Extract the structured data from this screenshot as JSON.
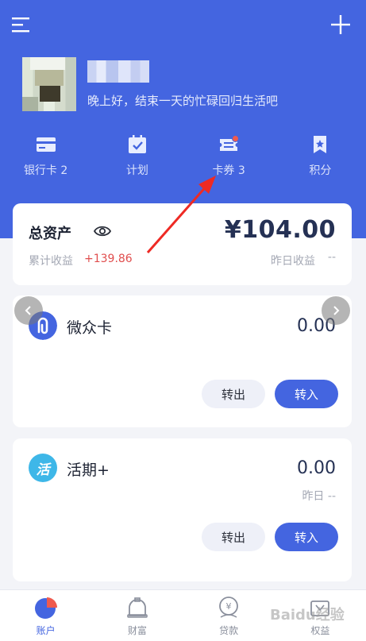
{
  "header": {
    "greeting": "晚上好，结束一天的忙碌回归生活吧"
  },
  "quick_nav": [
    {
      "label": "银行卡 2",
      "icon": "bank-card-icon"
    },
    {
      "label": "计划",
      "icon": "plan-calendar-icon"
    },
    {
      "label": "卡券 3",
      "icon": "coupon-icon",
      "badge": true
    },
    {
      "label": "积分",
      "icon": "points-bookmark-icon"
    }
  ],
  "assets": {
    "title": "总资产",
    "amount": "¥104.00",
    "cumulative_label": "累计收益",
    "cumulative_value": "+139.86",
    "yesterday_label": "昨日收益",
    "yesterday_value": "--"
  },
  "products": [
    {
      "name": "微众卡",
      "amount": "0.00",
      "transfer_out": "转出",
      "transfer_in": "转入",
      "icon": "weizhong-card-icon"
    },
    {
      "name": "活期+",
      "amount": "0.00",
      "yesterday": "昨日 --",
      "transfer_out": "转出",
      "transfer_in": "转入",
      "icon_text": "活"
    }
  ],
  "tabs": [
    {
      "label": "账户",
      "icon": "account-pie-icon",
      "active": true
    },
    {
      "label": "财富",
      "icon": "wealth-icon"
    },
    {
      "label": "贷款",
      "icon": "loan-icon"
    },
    {
      "label": "权益",
      "icon": "rights-icon"
    }
  ],
  "watermark": "Baidu经验",
  "colors": {
    "primary": "#4465e0",
    "positive": "#e04e4e",
    "badge": "#ef5a4e",
    "huoqi_icon": "#3eb7e8"
  }
}
